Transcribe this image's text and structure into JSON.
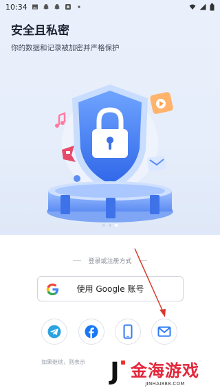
{
  "status_bar": {
    "time": "10:34"
  },
  "hero": {
    "title": "安全且私密",
    "subtitle": "你的数据和记录被加密并严格保护",
    "page_index": 2,
    "page_count": 3
  },
  "login": {
    "divider_text": "登录或注册方式",
    "google_button_label": "使用 Google 账号",
    "social_buttons": [
      "telegram-icon",
      "facebook-icon",
      "phone-icon",
      "email-icon"
    ],
    "terms_text": "如果继续，则表示"
  },
  "watermark": {
    "name": "金海游戏",
    "url": "JINHAI888.COM"
  },
  "colors": {
    "accent_blue": "#2f7bf5",
    "facebook_blue": "#1877f2",
    "telegram_blue": "#2aa3e0",
    "arrow_red": "#d8392b"
  }
}
